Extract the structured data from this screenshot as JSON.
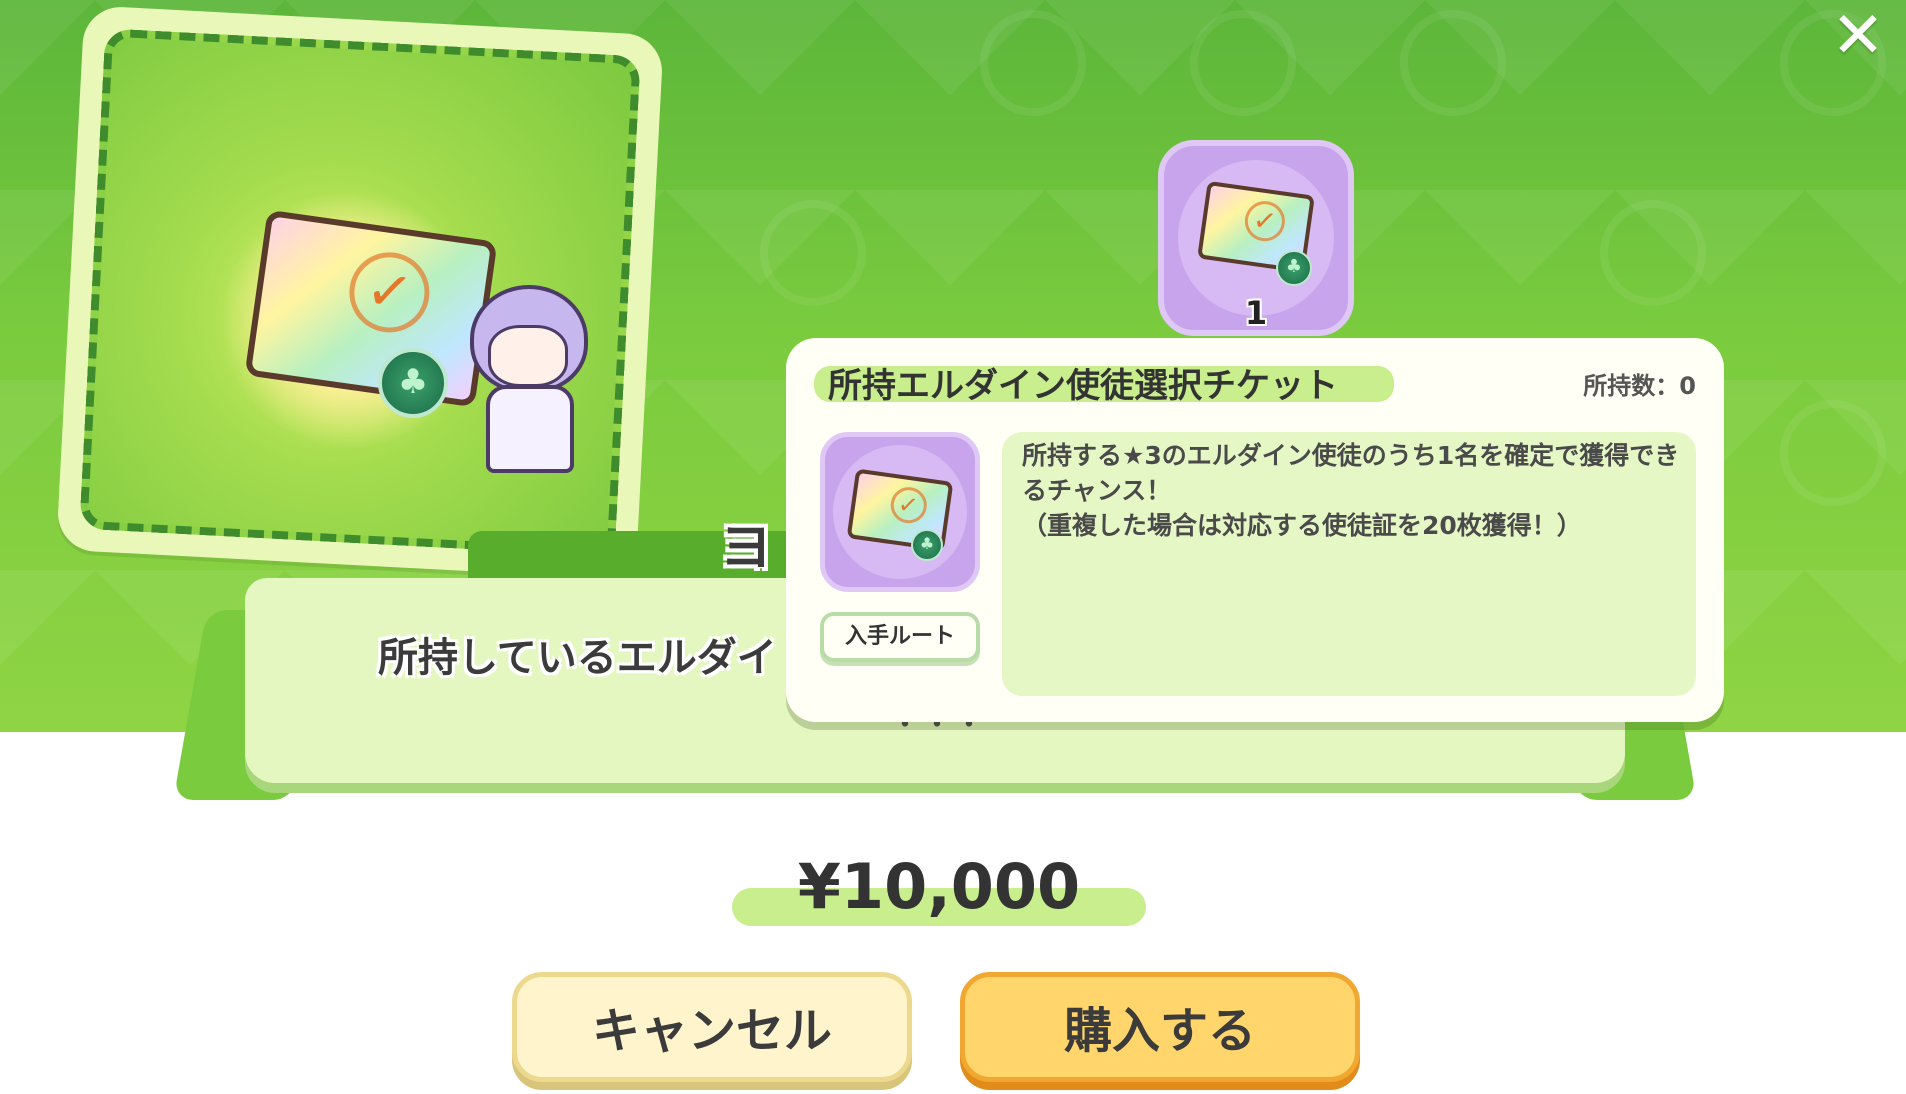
{
  "window": {
    "close_icon": "close-icon"
  },
  "item": {
    "icon": "ticket-icon"
  },
  "banner": {
    "title_visible": "ヨ",
    "text_visible": "所持しているエルダイ",
    "dots": "・・・"
  },
  "tooltip": {
    "icon_count": "1",
    "name": "所持エルダイン使徒選択チケット",
    "owned": "所持数：0",
    "route_button": "入手ルート",
    "description": "所持する★3のエルダイン使徒のうち1名を確定で獲得できるチャンス！\n（重複した場合は対応する使徒証を20枚獲得！）"
  },
  "purchase": {
    "price": "¥10,000",
    "cancel_label": "キャンセル",
    "buy_label": "購入する"
  },
  "colors": {
    "bg_green": "#7acb3e",
    "tooltip_bg": "#fffff6",
    "buy_button": "#ffd56c",
    "cancel_button": "#fff4cc"
  }
}
